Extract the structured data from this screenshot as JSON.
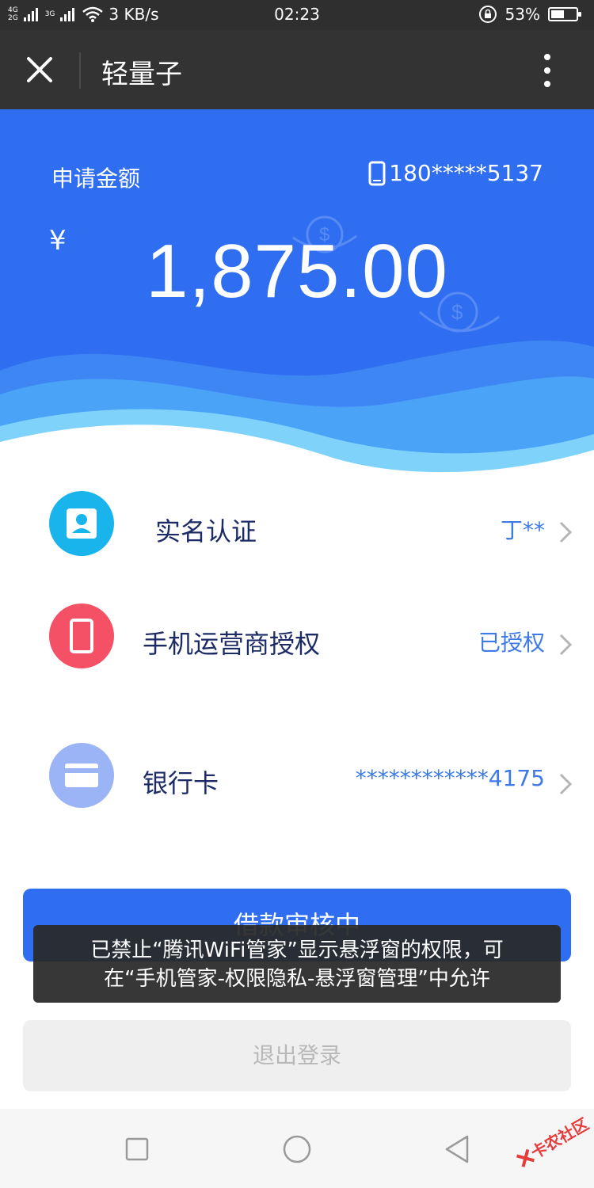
{
  "status_bar": {
    "net_top": "4G",
    "net_bottom": "2G",
    "net_3g": "3G",
    "speed": "3 KB/s",
    "time": "02:23",
    "battery": "53%",
    "battery_level": 0.53
  },
  "nav": {
    "title": "轻量子",
    "close_icon": "close-icon",
    "more_icon": "more-vertical-icon"
  },
  "hero": {
    "label": "申请金额",
    "phone": "180*****5137",
    "currency": "¥",
    "amount": "1,875.00"
  },
  "items": [
    {
      "label": "实名认证",
      "value": "丁**",
      "icon": "id-card-icon",
      "color": "#1ab4ec"
    },
    {
      "label": "手机运营商授权",
      "value": "已授权",
      "icon": "mobile-phone-icon",
      "color": "#f45166"
    },
    {
      "label": "银行卡",
      "value": "************4175",
      "icon": "bank-card-icon",
      "color": "#9ab4f6"
    }
  ],
  "primary_button": "借款审核中",
  "toast": {
    "line1": "已禁止“腾讯WiFi管家”显示悬浮窗的权限，可",
    "line2": "在“手机管家-权限隐私-悬浮窗管理”中允许"
  },
  "secondary_button": "退出登录",
  "watermark": "卡农社区",
  "colors": {
    "accent": "#2f6ef0",
    "link": "#3d7ae8"
  }
}
